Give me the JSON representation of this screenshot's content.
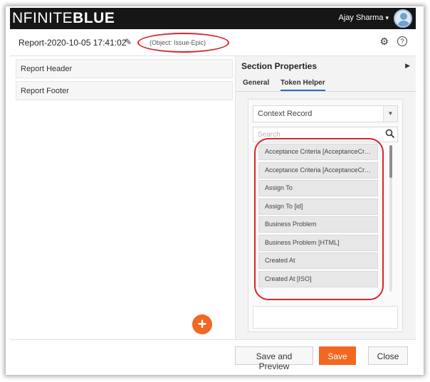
{
  "app": {
    "logo_prefix": "NFINITE",
    "logo_suffix": "BLUE"
  },
  "user": {
    "name": "Ajay Sharma",
    "caret": "▾"
  },
  "header": {
    "report_title": "Report-2020-10-05 17:41:02",
    "object_tag": "(Object: Issue-Epic)"
  },
  "sections": [
    {
      "label": "Report Header"
    },
    {
      "label": "Report Footer"
    }
  ],
  "panel": {
    "title": "Section Properties",
    "tabs": [
      {
        "label": "General",
        "active": false
      },
      {
        "label": "Token Helper",
        "active": true
      }
    ],
    "context_select": "Context Record",
    "search_placeholder": "Search",
    "tokens": [
      "Acceptance Criteria [AcceptanceCrite...",
      "Acceptance Criteria [AcceptanceCrite...",
      "Assign To",
      "Assign To [id]",
      "Business Problem",
      "Business Problem [HTML]",
      "Created At",
      "Created At [ISO]"
    ]
  },
  "footer": {
    "save_preview_label": "Save and Preview",
    "save_label": "Save",
    "close_label": "Close"
  },
  "colors": {
    "accent": "#f26722",
    "annotation": "#d9252b",
    "topbar": "#161616",
    "tab_underline": "#2a6ebb"
  }
}
